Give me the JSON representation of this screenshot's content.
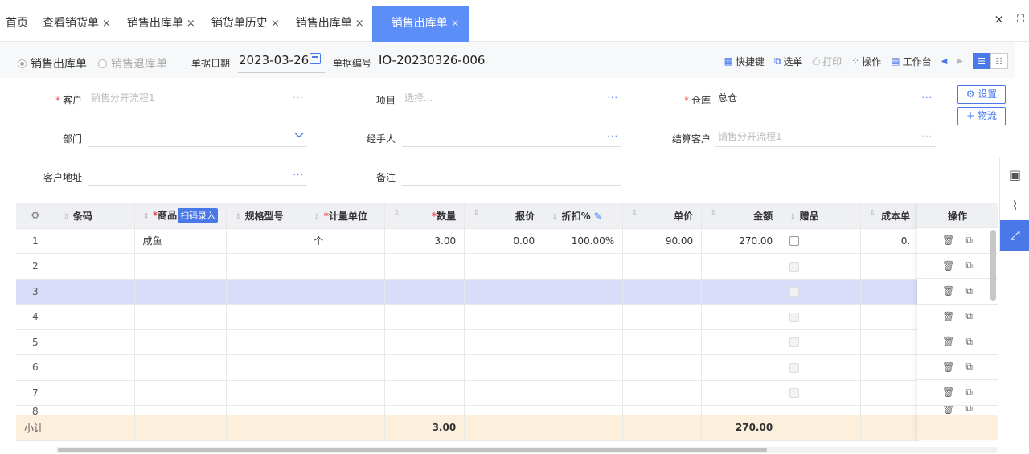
{
  "tabs": [
    {
      "label": "首页",
      "closable": false,
      "active": false
    },
    {
      "label": "查看销货单",
      "closable": true,
      "active": false
    },
    {
      "label": "销售出库单",
      "closable": true,
      "active": false
    },
    {
      "label": "销货单历史",
      "closable": true,
      "active": false
    },
    {
      "label": "销售出库单",
      "closable": true,
      "active": false
    },
    {
      "label": "销售出库单",
      "closable": true,
      "active": true
    }
  ],
  "tab_close_glyph": "×",
  "window": {
    "close": "×",
    "fullscreen": "⛶"
  },
  "toolbar": {
    "radio_out": "销售出库单",
    "radio_return": "销售退库单",
    "date_label": "单据日期",
    "date_value": "2023-03-26",
    "no_label": "单据编号",
    "no_value": "IO-20230326-006",
    "actions": {
      "shortcut": "快捷键",
      "select": "选单",
      "print": "打印",
      "operate": "操作",
      "workbench": "工作台"
    }
  },
  "form": {
    "customer_label": "客户",
    "customer_value": "销售分开流程1",
    "project_label": "项目",
    "project_placeholder": "选择...",
    "warehouse_label": "仓库",
    "warehouse_value": "总仓",
    "department_label": "部门",
    "handler_label": "经手人",
    "settle_label": "结算客户",
    "settle_value": "销售分开流程1",
    "address_label": "客户地址",
    "remark_label": "备注",
    "more": "···",
    "settings_button": "⚙ 设置",
    "logistics_button": "+ 物流"
  },
  "grid": {
    "headers": {
      "barcode": "条码",
      "product": "商品",
      "scan": "扫码录入",
      "spec": "规格型号",
      "unit": "计量单位",
      "qty": "数量",
      "quote": "报价",
      "discount": "折扣%",
      "price": "单价",
      "amount": "金额",
      "gift": "赠品",
      "cost": "成本单",
      "ops": "操作"
    },
    "rows": [
      {
        "idx": "1",
        "product": "咸鱼",
        "unit": "个",
        "qty": "3.00",
        "quote": "0.00",
        "discount": "100.00%",
        "price": "90.00",
        "amount": "270.00",
        "cost": "0."
      },
      {
        "idx": "2"
      },
      {
        "idx": "3"
      },
      {
        "idx": "4"
      },
      {
        "idx": "5"
      },
      {
        "idx": "6"
      },
      {
        "idx": "7"
      },
      {
        "idx": "8"
      }
    ],
    "subtotal": {
      "label": "小计",
      "qty": "3.00",
      "amount": "270.00"
    }
  }
}
